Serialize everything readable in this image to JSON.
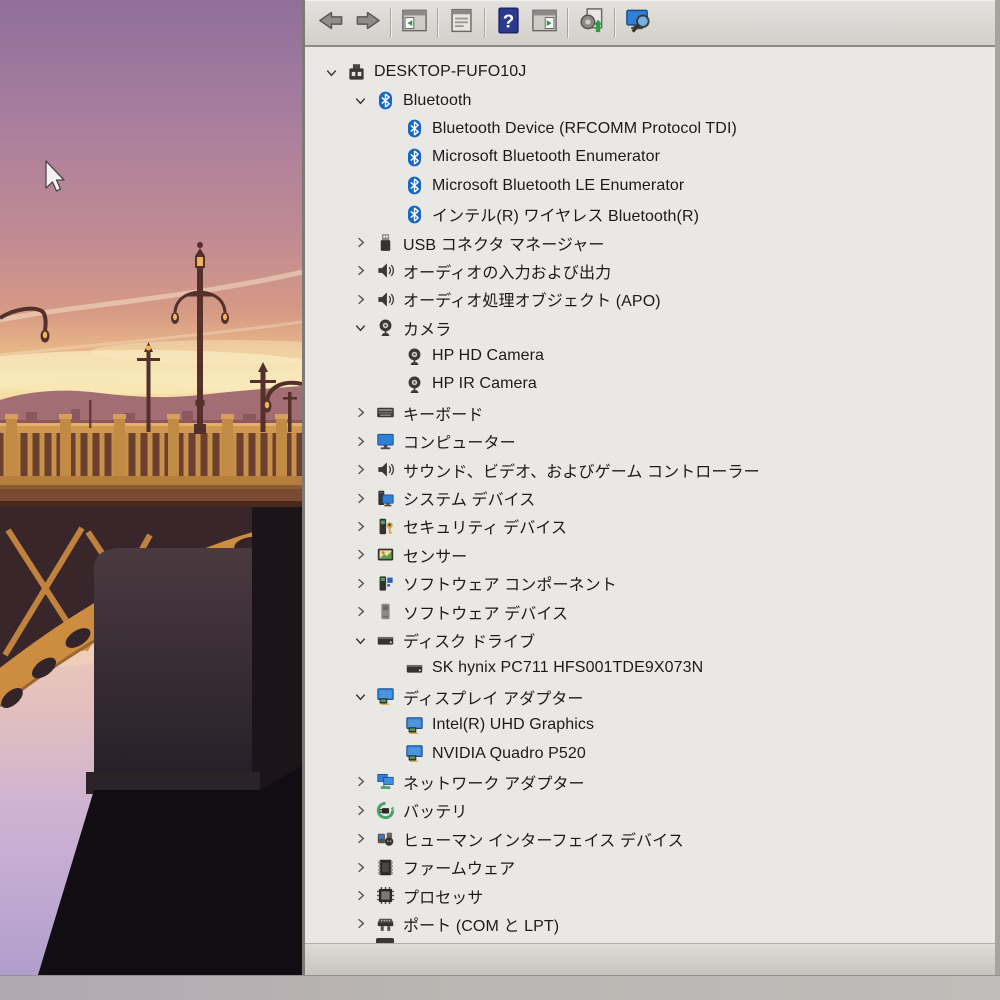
{
  "window": {
    "app": "device-manager",
    "toolbar": {
      "groups": [
        [
          {
            "name": "back-button",
            "icon": "back-arrow"
          },
          {
            "name": "forward-button",
            "icon": "forward-arrow"
          }
        ],
        [
          {
            "name": "show-console-tree-button",
            "icon": "console-tree-window"
          }
        ],
        [
          {
            "name": "properties-button",
            "icon": "properties-dialog"
          }
        ],
        [
          {
            "name": "help-button",
            "icon": "help-question"
          },
          {
            "name": "show-action-pane-button",
            "icon": "action-pane-window"
          }
        ],
        [
          {
            "name": "update-driver-button",
            "icon": "update-driver-gear"
          }
        ],
        [
          {
            "name": "scan-hardware-changes-button",
            "icon": "scan-hardware-monitor"
          }
        ]
      ]
    },
    "tree": {
      "items": [
        {
          "label": "DESKTOP-FUFO10J",
          "level": 0,
          "icon": "computer-root",
          "state": "expanded"
        },
        {
          "label": "Bluetooth",
          "level": 1,
          "icon": "bluetooth",
          "state": "expanded"
        },
        {
          "label": "Bluetooth Device (RFCOMM Protocol TDI)",
          "level": 2,
          "icon": "bluetooth",
          "state": "leaf"
        },
        {
          "label": "Microsoft Bluetooth Enumerator",
          "level": 2,
          "icon": "bluetooth",
          "state": "leaf"
        },
        {
          "label": "Microsoft Bluetooth LE Enumerator",
          "level": 2,
          "icon": "bluetooth",
          "state": "leaf"
        },
        {
          "label": "インテル(R) ワイヤレス Bluetooth(R)",
          "level": 2,
          "icon": "bluetooth",
          "state": "leaf"
        },
        {
          "label": "USB コネクタ マネージャー",
          "level": 1,
          "icon": "usb",
          "state": "collapsed"
        },
        {
          "label": "オーディオの入力および出力",
          "level": 1,
          "icon": "audio",
          "state": "collapsed"
        },
        {
          "label": "オーディオ処理オブジェクト (APO)",
          "level": 1,
          "icon": "audio",
          "state": "collapsed"
        },
        {
          "label": "カメラ",
          "level": 1,
          "icon": "camera",
          "state": "expanded"
        },
        {
          "label": "HP HD Camera",
          "level": 2,
          "icon": "camera",
          "state": "leaf"
        },
        {
          "label": "HP IR Camera",
          "level": 2,
          "icon": "camera",
          "state": "leaf"
        },
        {
          "label": "キーボード",
          "level": 1,
          "icon": "keyboard",
          "state": "collapsed"
        },
        {
          "label": "コンピューター",
          "level": 1,
          "icon": "monitor",
          "state": "collapsed"
        },
        {
          "label": "サウンド、ビデオ、およびゲーム コントローラー",
          "level": 1,
          "icon": "audio",
          "state": "collapsed"
        },
        {
          "label": "システム デバイス",
          "level": 1,
          "icon": "system",
          "state": "collapsed"
        },
        {
          "label": "セキュリティ デバイス",
          "level": 1,
          "icon": "security",
          "state": "collapsed"
        },
        {
          "label": "センサー",
          "level": 1,
          "icon": "sensor",
          "state": "collapsed"
        },
        {
          "label": "ソフトウェア コンポーネント",
          "level": 1,
          "icon": "software-component",
          "state": "collapsed"
        },
        {
          "label": "ソフトウェア デバイス",
          "level": 1,
          "icon": "software-device",
          "state": "collapsed"
        },
        {
          "label": "ディスク ドライブ",
          "level": 1,
          "icon": "disk",
          "state": "expanded"
        },
        {
          "label": "SK hynix PC711 HFS001TDE9X073N",
          "level": 2,
          "icon": "disk",
          "state": "leaf"
        },
        {
          "label": "ディスプレイ アダプター",
          "level": 1,
          "icon": "display",
          "state": "expanded"
        },
        {
          "label": "Intel(R) UHD Graphics",
          "level": 2,
          "icon": "display",
          "state": "leaf"
        },
        {
          "label": "NVIDIA Quadro P520",
          "level": 2,
          "icon": "display",
          "state": "leaf"
        },
        {
          "label": "ネットワーク アダプター",
          "level": 1,
          "icon": "network",
          "state": "collapsed"
        },
        {
          "label": "バッテリ",
          "level": 1,
          "icon": "battery",
          "state": "collapsed"
        },
        {
          "label": "ヒューマン インターフェイス デバイス",
          "level": 1,
          "icon": "hid",
          "state": "collapsed"
        },
        {
          "label": "ファームウェア",
          "level": 1,
          "icon": "firmware",
          "state": "collapsed"
        },
        {
          "label": "プロセッサ",
          "level": 1,
          "icon": "processor",
          "state": "collapsed"
        },
        {
          "label": "ポート (COM と LPT)",
          "level": 1,
          "icon": "port",
          "state": "collapsed"
        }
      ],
      "partial_next_item": true
    }
  },
  "desktop": {
    "wallpaper": "sunset-bridge-photo",
    "cursor": "arrow-cursor"
  },
  "colors": {
    "bluetooth_blue": "#1566c9",
    "monitor_blue": "#2f7fd6",
    "toolbar_bg": "#d6d3cf",
    "tree_bg": "#eae8e4",
    "action_green": "#2e9e44",
    "arch_gold": "#cd8d41"
  }
}
